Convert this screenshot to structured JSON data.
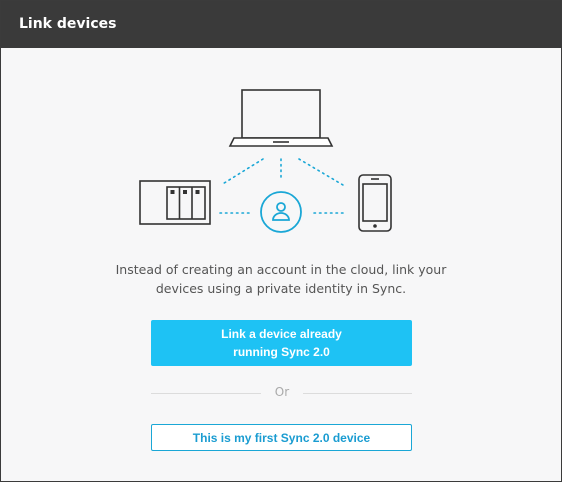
{
  "window": {
    "title": "Link devices"
  },
  "illustration": {
    "icons": [
      "laptop-icon",
      "nas-server-icon",
      "identity-user-icon",
      "smartphone-icon"
    ],
    "line_color": "#1aa7d6",
    "device_color": "#333333"
  },
  "description": {
    "line1": "Instead of creating an account in the cloud, link your",
    "line2": "devices using a private identity in Sync."
  },
  "primary_button": {
    "line1": "Link a device already",
    "line2": "running Sync 2.0",
    "color": "#1ec2f4"
  },
  "divider": {
    "label": "Or"
  },
  "secondary_button": {
    "label": "This is my first Sync 2.0 device"
  }
}
